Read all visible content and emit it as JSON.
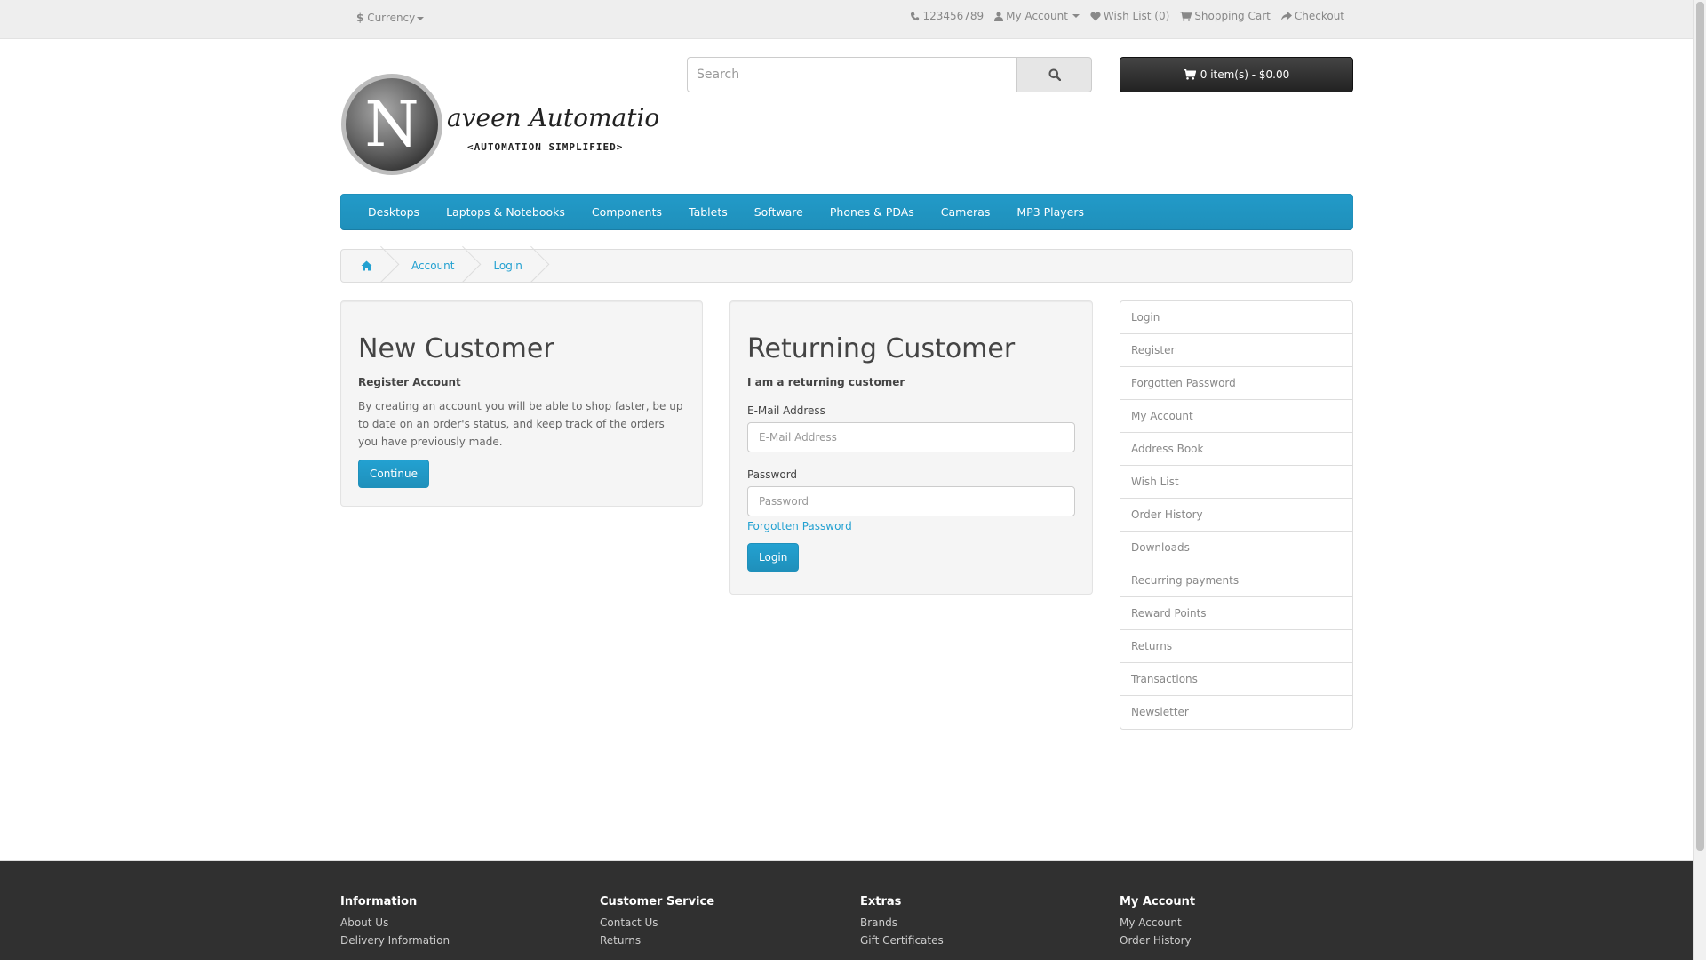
{
  "topbar": {
    "currency_symbol": "$",
    "currency_label": "Currency",
    "phone": "123456789",
    "my_account": "My Account",
    "wish_list": "Wish List (0)",
    "shopping_cart": "Shopping Cart",
    "checkout": "Checkout"
  },
  "header": {
    "logo_text": "aveen Automation Labs",
    "logo_initial": "N",
    "logo_tagline": "<AUTOMATION SIMPLIFIED>",
    "search_placeholder": "Search",
    "cart_label": "0 item(s) - $0.00"
  },
  "menu": {
    "items": [
      "Desktops",
      "Laptops & Notebooks",
      "Components",
      "Tablets",
      "Software",
      "Phones & PDAs",
      "Cameras",
      "MP3 Players"
    ]
  },
  "breadcrumb": {
    "items": [
      "Account",
      "Login"
    ]
  },
  "new_customer": {
    "title": "New Customer",
    "subtitle": "Register Account",
    "description": "By creating an account you will be able to shop faster, be up to date on an order's status, and keep track of the orders you have previously made.",
    "button": "Continue"
  },
  "returning_customer": {
    "title": "Returning Customer",
    "subtitle": "I am a returning customer",
    "email_label": "E-Mail Address",
    "email_placeholder": "E-Mail Address",
    "password_label": "Password",
    "password_placeholder": "Password",
    "forgotten": "Forgotten Password",
    "button": "Login"
  },
  "account_list": {
    "items": [
      "Login",
      "Register",
      "Forgotten Password",
      "My Account",
      "Address Book",
      "Wish List",
      "Order History",
      "Downloads",
      "Recurring payments",
      "Reward Points",
      "Returns",
      "Transactions",
      "Newsletter"
    ]
  },
  "footer": {
    "columns": [
      {
        "title": "Information",
        "links": [
          "About Us",
          "Delivery Information"
        ]
      },
      {
        "title": "Customer Service",
        "links": [
          "Contact Us",
          "Returns"
        ]
      },
      {
        "title": "Extras",
        "links": [
          "Brands",
          "Gift Certificates"
        ]
      },
      {
        "title": "My Account",
        "links": [
          "My Account",
          "Order History"
        ]
      }
    ]
  },
  "colors": {
    "accent": "#229ac8",
    "link": "#23a1d1",
    "footer_bg": "#303030"
  }
}
